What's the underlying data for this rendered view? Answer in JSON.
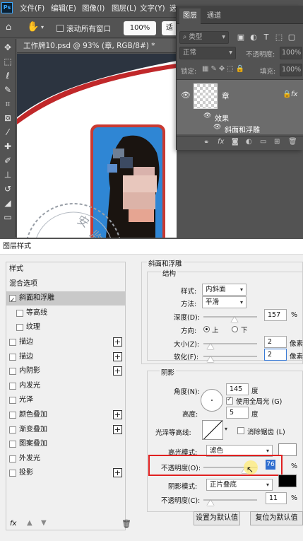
{
  "app": {
    "logo": "Ps",
    "menu": [
      "文件(F)",
      "编辑(E)",
      "图像(I)",
      "图层(L)",
      "文字(Y)",
      "选"
    ]
  },
  "options_bar": {
    "scroll_all_windows_label": "滚动所有窗口",
    "zoom_value": "100%",
    "fit_label": "适"
  },
  "document": {
    "tab_title": "工作牌10.psd @ 93% (章, RGB/8#) *"
  },
  "layers_panel": {
    "tabs": [
      "图层",
      "通道"
    ],
    "filter_kind": "类型",
    "blend_mode": "正常",
    "opacity_label": "不透明度:",
    "opacity_value": "100%",
    "lock_label": "锁定:",
    "fill_label": "填充:",
    "fill_value": "100%",
    "layer_name": "章",
    "effects_label": "效果",
    "effect_item": "斜面和浮雕"
  },
  "dialog": {
    "title": "图层样式",
    "style_list": [
      {
        "label": "样式",
        "checkbox": false,
        "plus": false
      },
      {
        "label": "混合选项",
        "checkbox": false,
        "plus": false
      },
      {
        "label": "斜面和浮雕",
        "checkbox": true,
        "checked": true,
        "plus": false,
        "selected": true
      },
      {
        "label": "等高线",
        "checkbox": true,
        "checked": false,
        "plus": false,
        "indent": true
      },
      {
        "label": "纹理",
        "checkbox": true,
        "checked": false,
        "plus": false,
        "indent": true
      },
      {
        "label": "描边",
        "checkbox": true,
        "checked": false,
        "plus": true
      },
      {
        "label": "描边",
        "checkbox": true,
        "checked": false,
        "plus": true
      },
      {
        "label": "内阴影",
        "checkbox": true,
        "checked": false,
        "plus": true
      },
      {
        "label": "内发光",
        "checkbox": true,
        "checked": false,
        "plus": false
      },
      {
        "label": "光泽",
        "checkbox": true,
        "checked": false,
        "plus": false
      },
      {
        "label": "颜色叠加",
        "checkbox": true,
        "checked": false,
        "plus": true
      },
      {
        "label": "渐变叠加",
        "checkbox": true,
        "checked": false,
        "plus": true
      },
      {
        "label": "图案叠加",
        "checkbox": true,
        "checked": false,
        "plus": false
      },
      {
        "label": "外发光",
        "checkbox": true,
        "checked": false,
        "plus": false
      },
      {
        "label": "投影",
        "checkbox": true,
        "checked": false,
        "plus": true
      }
    ],
    "bottom_icons": [
      "fx-icon",
      "arrow-up-icon",
      "arrow-down-icon",
      "trash-icon"
    ],
    "section_title": "斜面和浮雕",
    "structure": {
      "title": "结构",
      "style_label": "样式:",
      "style_value": "内斜面",
      "technique_label": "方法:",
      "technique_value": "平滑",
      "depth_label": "深度(D):",
      "depth_value": "157",
      "depth_unit": "%",
      "direction_label": "方向:",
      "direction_up": "上",
      "direction_down": "下",
      "size_label": "大小(Z):",
      "size_value": "2",
      "size_unit": "像素",
      "soften_label": "软化(F):",
      "soften_value": "2",
      "soften_unit": "像素"
    },
    "shading": {
      "title": "阴影",
      "angle_label": "角度(N):",
      "angle_value": "145",
      "angle_unit": "度",
      "global_light_label": "使用全局光 (G)",
      "altitude_label": "高度:",
      "altitude_value": "5",
      "altitude_unit": "度",
      "gloss_contour_label": "光泽等高线:",
      "anti_alias_label": "消除锯齿 (L)",
      "highlight_mode_label": "高光模式:",
      "highlight_mode_value": "滤色",
      "highlight_opacity_label": "不透明度(O):",
      "highlight_opacity_value": "76",
      "highlight_opacity_unit": "%",
      "shadow_mode_label": "阴影模式:",
      "shadow_mode_value": "正片叠底",
      "shadow_opacity_label": "不透明度(C):",
      "shadow_opacity_value": "11",
      "shadow_opacity_unit": "%"
    },
    "buttons": {
      "set_default": "设置为默认值",
      "reset_default": "复位为默认值"
    },
    "colors": {
      "highlight_swatch": "#ffffff",
      "shadow_swatch": "#000000",
      "annotation_red": "#e02020"
    }
  }
}
